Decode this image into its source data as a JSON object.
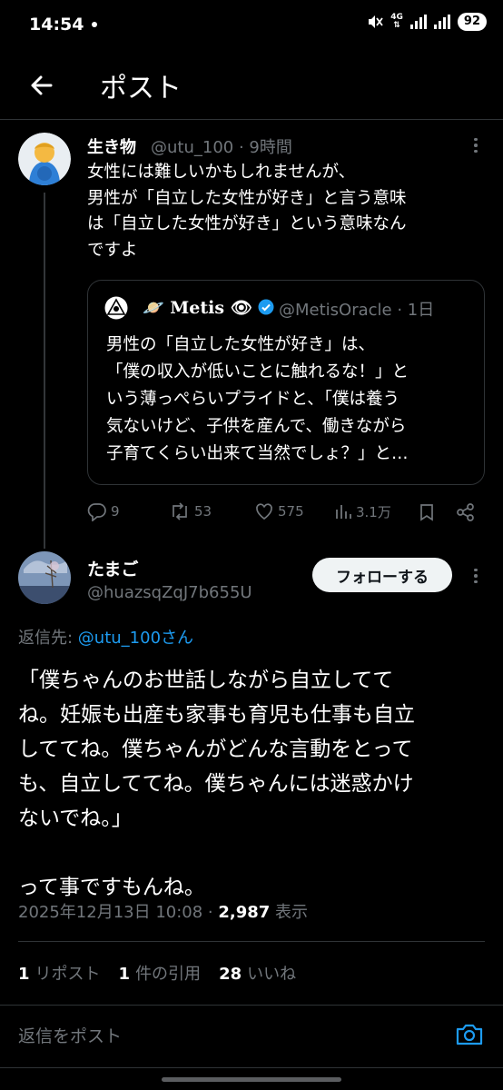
{
  "status_bar": {
    "time": "14:54",
    "network": "4G",
    "battery": "92"
  },
  "header": {
    "title": "ポスト"
  },
  "parent_tweet": {
    "name": "生き物",
    "handle_time": "@utu_100 · 9時間",
    "text": "女性には難しいかもしれませんが、\n男性が「自立した女性が好き」と言う意味\nは「自立した女性が好き」という意味なん\nですよ",
    "quote": {
      "name": "🪐 Metis 👁",
      "handle_time": "@MetisOracle · 1日",
      "text": "男性の「自立した女性が好き」は、\n「僕の収入が低いことに触れるな！」と\nいう薄っぺらいプライドと、「僕は養う\n気ないけど、子供を産んで、働きながら\n子育てくらい出来て当然でしょ？」と…"
    },
    "actions": {
      "replies": "9",
      "reposts": "53",
      "likes": "575",
      "views": "3.1万"
    }
  },
  "reply_tweet": {
    "name": "たまご",
    "handle": "@huazsqZqJ7b655U",
    "follow_label": "フォローする",
    "reply_to_prefix": "返信先: ",
    "reply_to_user": "@utu_100さん",
    "text": "「僕ちゃんのお世話しながら自立してて\nね。妊娠も出産も家事も育児も仕事も自立\nしててね。僕ちゃんがどんな言動をとって\nも、自立しててね。僕ちゃんには迷惑かけ\nないでね。」\n\nって事ですもんね。",
    "date": "2025年12月13日 10:08 · ",
    "views_count": "2,987",
    "views_label": " 表示",
    "stats": {
      "reposts_count": "1",
      "reposts_label": "リポスト",
      "quotes_count": "1",
      "quotes_label": "件の引用",
      "likes_count": "28",
      "likes_label": "いいね"
    }
  },
  "reply_box": {
    "placeholder": "返信をポスト"
  },
  "colors": {
    "background": "#000000",
    "accent": "#1d9bf0",
    "muted": "#71767b",
    "divider": "#2f3336"
  }
}
